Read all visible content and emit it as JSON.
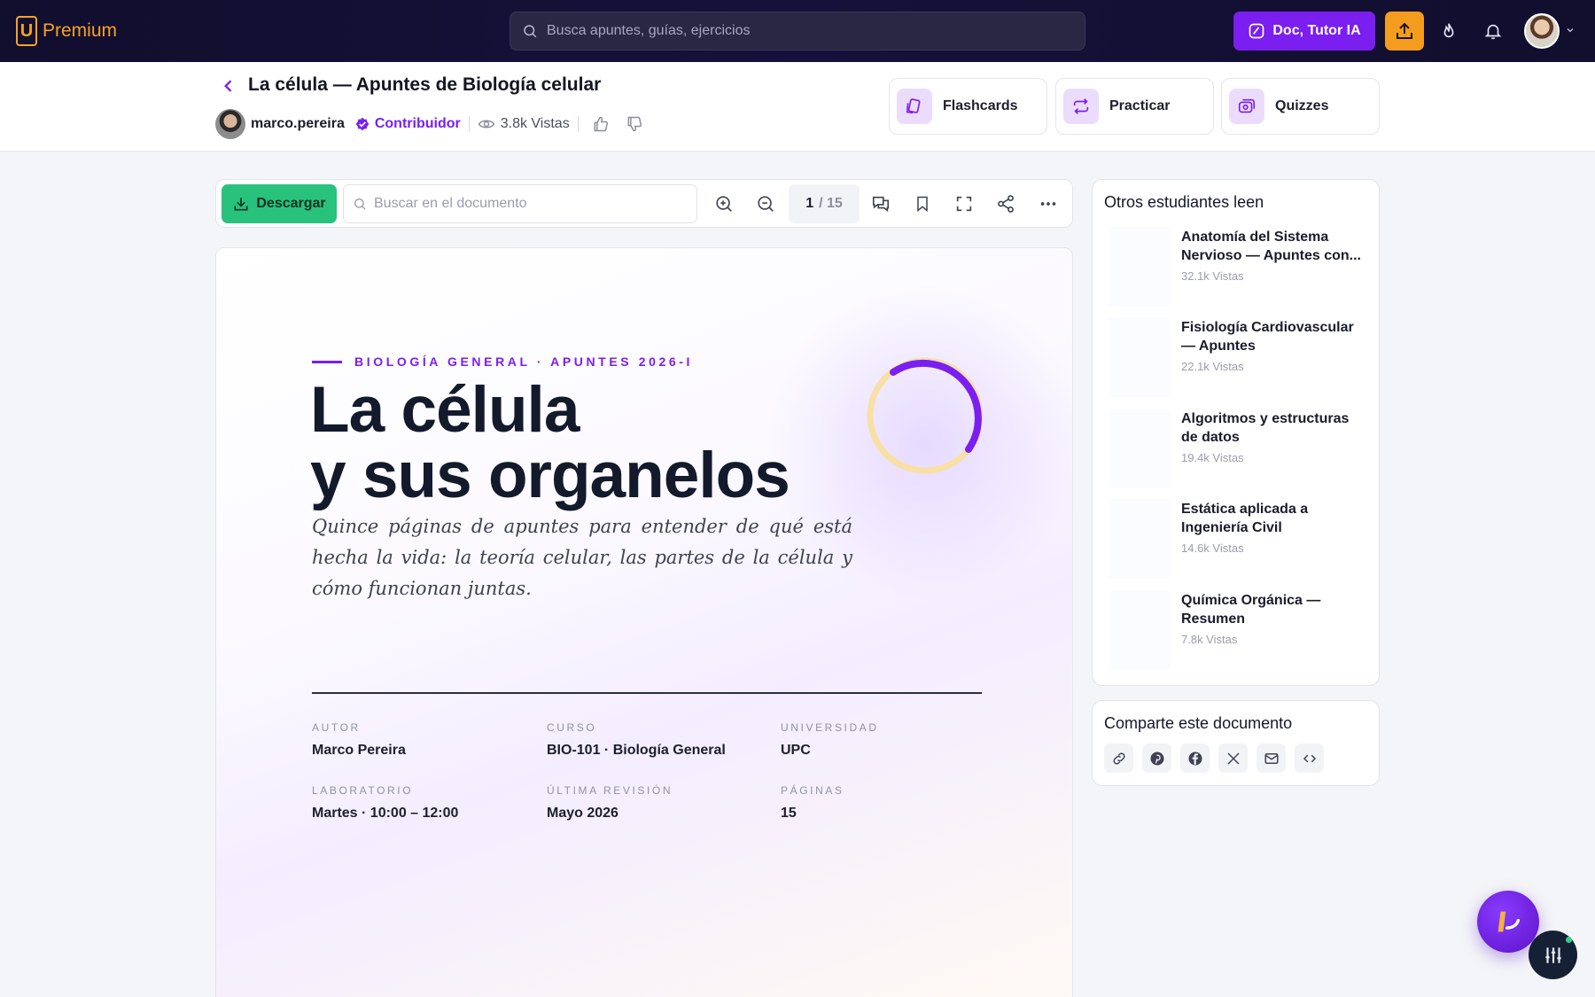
{
  "topbar": {
    "logo_letter": "U",
    "logo_text": "Premium",
    "search_placeholder": "Busca apuntes, guías, ejercicios",
    "tutor_button": "Doc, Tutor IA"
  },
  "titlebar": {
    "title": "La célula — Apuntes de Biología celular",
    "username": "marco.pereira",
    "role": "Contribuidor",
    "views": "3.8k Vistas",
    "actions": [
      {
        "label": "Flashcards",
        "icon": "cards-icon"
      },
      {
        "label": "Practicar",
        "icon": "repeat-icon"
      },
      {
        "label": "Quizzes",
        "icon": "quiz-icon"
      }
    ]
  },
  "toolbar": {
    "download_label": "Descargar",
    "search_placeholder": "Buscar en el documento",
    "page_current": "1",
    "page_total": "/ 15"
  },
  "document": {
    "eyebrow": "BIOLOGÍA GENERAL · APUNTES 2026-I",
    "title_line1": "La célula",
    "title_line2": "y sus organelos",
    "subtitle": "Quince páginas de apuntes para entender de qué está hecha la vida: la teoría celular, las partes de la célula y cómo funcionan juntas.",
    "info": [
      {
        "label": "AUTOR",
        "value": "Marco Pereira"
      },
      {
        "label": "CURSO",
        "value": "BIO-101 · Biología General"
      },
      {
        "label": "UNIVERSIDAD",
        "value": "UPC"
      },
      {
        "label": "LABORATORIO",
        "value": "Martes · 10:00 – 12:00"
      },
      {
        "label": "ÚLTIMA REVISIÓN",
        "value": "Mayo 2026"
      },
      {
        "label": "PÁGINAS",
        "value": "15"
      }
    ]
  },
  "sidebar": {
    "others_title": "Otros estudiantes leen",
    "recommendations": [
      {
        "title": "Anatomía del Sistema Nervioso — Apuntes con...",
        "views": "32.1k Vistas",
        "color": "#c9d6f5"
      },
      {
        "title": "Fisiología Cardiovascular — Apuntes",
        "views": "22.1k Vistas",
        "color": "#c8efe3"
      },
      {
        "title": "Algoritmos y estructuras de datos",
        "views": "19.4k Vistas",
        "color": "#c9d6f5"
      },
      {
        "title": "Estática aplicada a Ingeniería Civil",
        "views": "14.6k Vistas",
        "color": "#f3cfe6"
      },
      {
        "title": "Química Orgánica — Resumen",
        "views": "7.8k Vistas",
        "color": "#f6e6cf"
      }
    ],
    "share_title": "Comparte este documento",
    "share_icons": [
      "link-icon",
      "pinterest-icon",
      "facebook-icon",
      "x-icon",
      "mail-icon",
      "embed-icon"
    ]
  },
  "colors": {
    "accent": "#7b1ef0",
    "download": "#28c27c",
    "upload": "#f39c1d",
    "topbar": "#130f33"
  }
}
